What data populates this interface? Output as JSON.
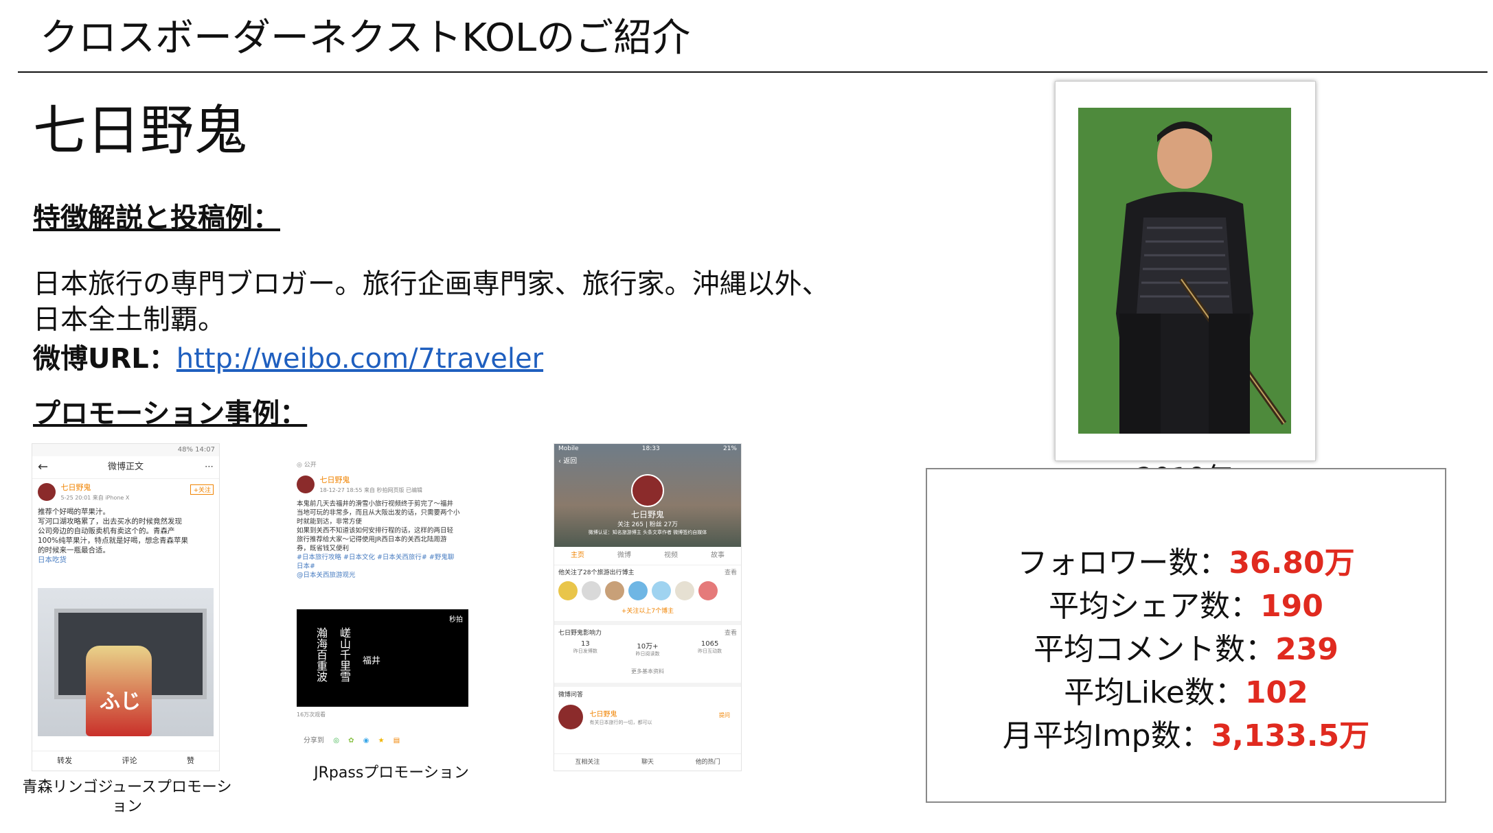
{
  "slide": {
    "title": "クロスボーダーネクストKOLのご紹介",
    "kol_name": "七日野鬼",
    "features_heading": "特徴解説と投稿例：",
    "description": "日本旅行の専門ブロガー。旅行企画専門家、旅行家。沖縄以外、日本全土制覇。",
    "weibo_label": "微博URL：",
    "weibo_url": "http://weibo.com/7traveler",
    "promo_heading": "プロモーション事例："
  },
  "photo": {
    "year_label": "2019年"
  },
  "stats": [
    {
      "label": "フォロワー数：",
      "value": "36.80万"
    },
    {
      "label": "平均シェア数：",
      "value": "190"
    },
    {
      "label": "平均コメント数：",
      "value": "239"
    },
    {
      "label": "平均Like数：",
      "value": "102"
    },
    {
      "label": "月平均Imp数：",
      "value": "3,133.5万"
    }
  ],
  "shot1": {
    "status_right": "48% 14:07",
    "header_title": "微博正文",
    "user_name": "七日野鬼",
    "meta": "5-25 20:01 来自 iPhone X",
    "follow": "+关注",
    "post_lines": [
      "推荐个好喝的苹果汁。",
      "写河口湖攻略累了，出去买水的时候竟然发现",
      "公司旁边的自动贩卖机有卖这个的。青森产",
      "100%纯苹果汁，特点就是好喝，想念青森苹果",
      "的时候来一瓶最合适。"
    ],
    "tag": "日本吃货",
    "product_text": "ふじ",
    "actions": [
      "转发",
      "评论",
      "赞"
    ],
    "caption": "青森リンゴジュースプロモーション"
  },
  "shot2": {
    "public": "公开",
    "user_name": "七日野鬼",
    "meta": "18-12-27 18:55 来自 秒拍网页版 已编辑",
    "post_lines": [
      "本鬼前几天去福井的滑雪小旅行视频终于剪完了～福井",
      "当地可玩的非常多，而且从大阪出发的话，只需要两个小",
      "时就能到达，非常方便",
      "如果到关西不知道该如何安排行程的话，这样的两日轻",
      "旅行推荐给大家～记得使用JR西日本的关西北陆周游",
      "券，既省钱又便利"
    ],
    "tags_line1": "#日本旅行攻略 #日本文化 #日本关西旅行# #野鬼聊",
    "tags_line2": "日本#",
    "tags_line3": "@日本关西旅游观光",
    "video_badge": "秒拍",
    "video_poem": [
      "瀚海百重波",
      "嵯山千里雪"
    ],
    "video_place": "福井",
    "views": "16万次观看",
    "share_label": "分享到",
    "caption": "JRpassプロモーション"
  },
  "shot3": {
    "status_left": "Mobile",
    "status_time": "18:33",
    "status_right": "21%",
    "back": "返回",
    "profile_name": "七日野鬼",
    "profile_stats": "关注 265 | 粉丝 27万",
    "profile_bio": "微博认证：知名旅游博主 头条文章作者 微博签约自媒体",
    "tabs": [
      "主页",
      "微博",
      "视频",
      "故事"
    ],
    "follow_section": "他关注了28个旅游出行博主",
    "see_all": "查看",
    "follow_more": "+关注以上7个博主",
    "influence_title": "七日野鬼影响力",
    "influence": [
      {
        "value": "13",
        "label": "昨日发博数"
      },
      {
        "value": "10万+",
        "label": "昨日阅读数"
      },
      {
        "value": "1065",
        "label": "昨日互动数"
      }
    ],
    "more_info": "更多基本资料",
    "qa_title": "微博问答",
    "qa_user": "七日野鬼",
    "qa_text": "有关日本旅行的一切，都可以",
    "qa_action": "提问",
    "bottom": [
      "互相关注",
      "聊天",
      "他的热门"
    ]
  },
  "colors": {
    "accent_red": "#e02a1f",
    "link_blue": "#1f5fbf",
    "weibo_orange": "#f08300"
  }
}
